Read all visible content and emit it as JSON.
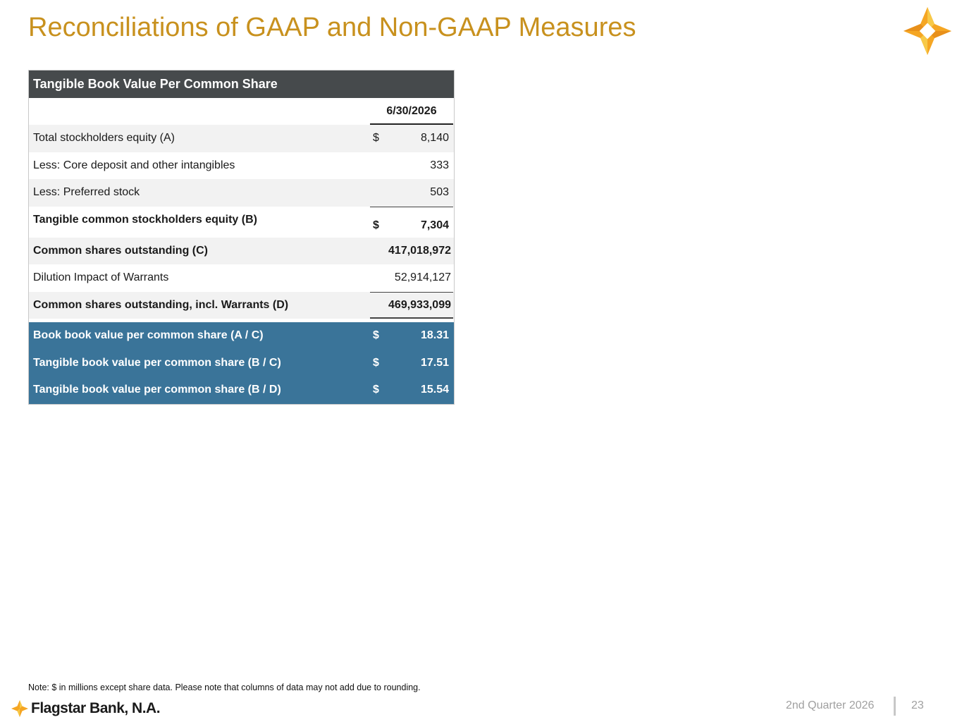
{
  "page": {
    "title": "Reconciliations of GAAP and Non-GAAP Measures",
    "note": "Note: $ in millions except share data.  Please note that columns of data may not add due to rounding.",
    "brand": "Flagstar Bank, N.A.",
    "quarter": "2nd Quarter 2026",
    "page_number": "23"
  },
  "table": {
    "header": "Tangible Book Value Per Common Share",
    "column_date": "6/30/2026",
    "rows": [
      {
        "label": "Total stockholders equity (A)",
        "currency": "$",
        "value": "8,140"
      },
      {
        "label": "Less: Core deposit and other intangibles",
        "currency": "",
        "value": "333"
      },
      {
        "label": "Less: Preferred stock",
        "currency": "",
        "value": "503"
      },
      {
        "label": "Tangible common stockholders equity (B)",
        "currency": "$",
        "value": "7,304"
      },
      {
        "label": "Common shares outstanding (C)",
        "currency": "",
        "value": "417,018,972"
      },
      {
        "label": "Dilution Impact of Warrants",
        "currency": "",
        "value": "52,914,127"
      },
      {
        "label": "Common shares outstanding, incl. Warrants (D)",
        "currency": "",
        "value": "469,933,099"
      }
    ],
    "summary_rows": [
      {
        "label": "Book book value per common share (A / C)",
        "currency": "$",
        "value": "18.31"
      },
      {
        "label": "Tangible book value per common share (B / C)",
        "currency": "$",
        "value": "17.51"
      },
      {
        "label": "Tangible book value per common share (B / D)",
        "currency": "$",
        "value": "15.54"
      }
    ]
  },
  "colors": {
    "title": "#c8911e",
    "header_bg": "#464a4c",
    "summary_bg": "#3a7499",
    "logo_primary": "#f5a623",
    "logo_secondary": "#f7c948"
  },
  "icons": {
    "logo": "flagstar-star-icon"
  }
}
